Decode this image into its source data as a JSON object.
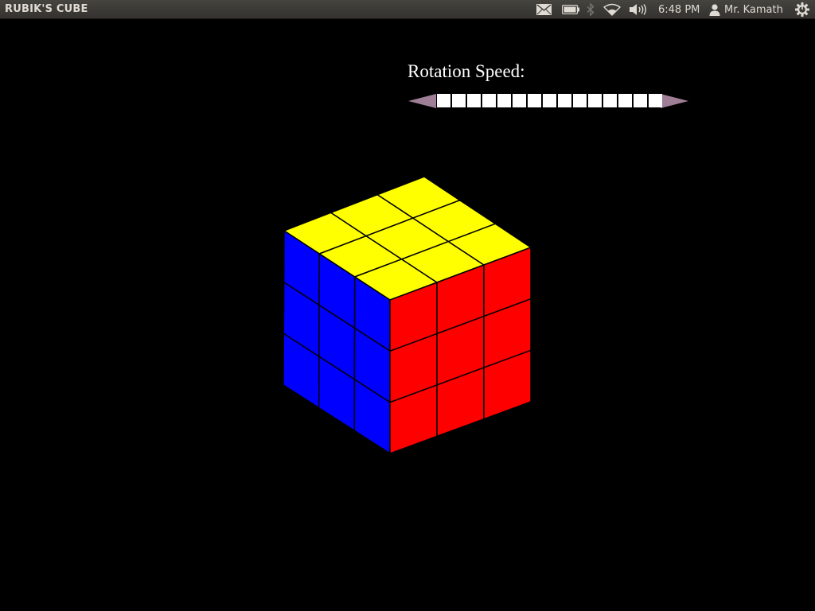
{
  "panel": {
    "app_title": "RUBIK'S CUBE",
    "clock": "6:48 PM",
    "user_name": "Mr. Kamath",
    "indicators": [
      "mail-icon",
      "battery-icon",
      "bluetooth-icon",
      "wifi-icon",
      "volume-icon",
      "session-gear-icon"
    ]
  },
  "speed": {
    "label": "Rotation Speed:",
    "segments_total": 15,
    "segments_filled": 15,
    "arrow_color": "#9e7f96"
  },
  "cube": {
    "colors": {
      "top": "#ffff00",
      "left": "#0000ff",
      "right": "#ff0000",
      "border": "#000000"
    },
    "faces": {
      "top": [
        [
          "#ffff00",
          "#ffff00",
          "#ffff00"
        ],
        [
          "#ffff00",
          "#ffff00",
          "#ffff00"
        ],
        [
          "#ffff00",
          "#ffff00",
          "#ffff00"
        ]
      ],
      "left": [
        [
          "#0000ff",
          "#0000ff",
          "#0000ff"
        ],
        [
          "#0000ff",
          "#0000ff",
          "#0000ff"
        ],
        [
          "#0000ff",
          "#0000ff",
          "#0000ff"
        ]
      ],
      "right": [
        [
          "#ff0000",
          "#ff0000",
          "#ff0000"
        ],
        [
          "#ff0000",
          "#ff0000",
          "#ff0000"
        ],
        [
          "#ff0000",
          "#ff0000",
          "#ff0000"
        ]
      ]
    }
  }
}
